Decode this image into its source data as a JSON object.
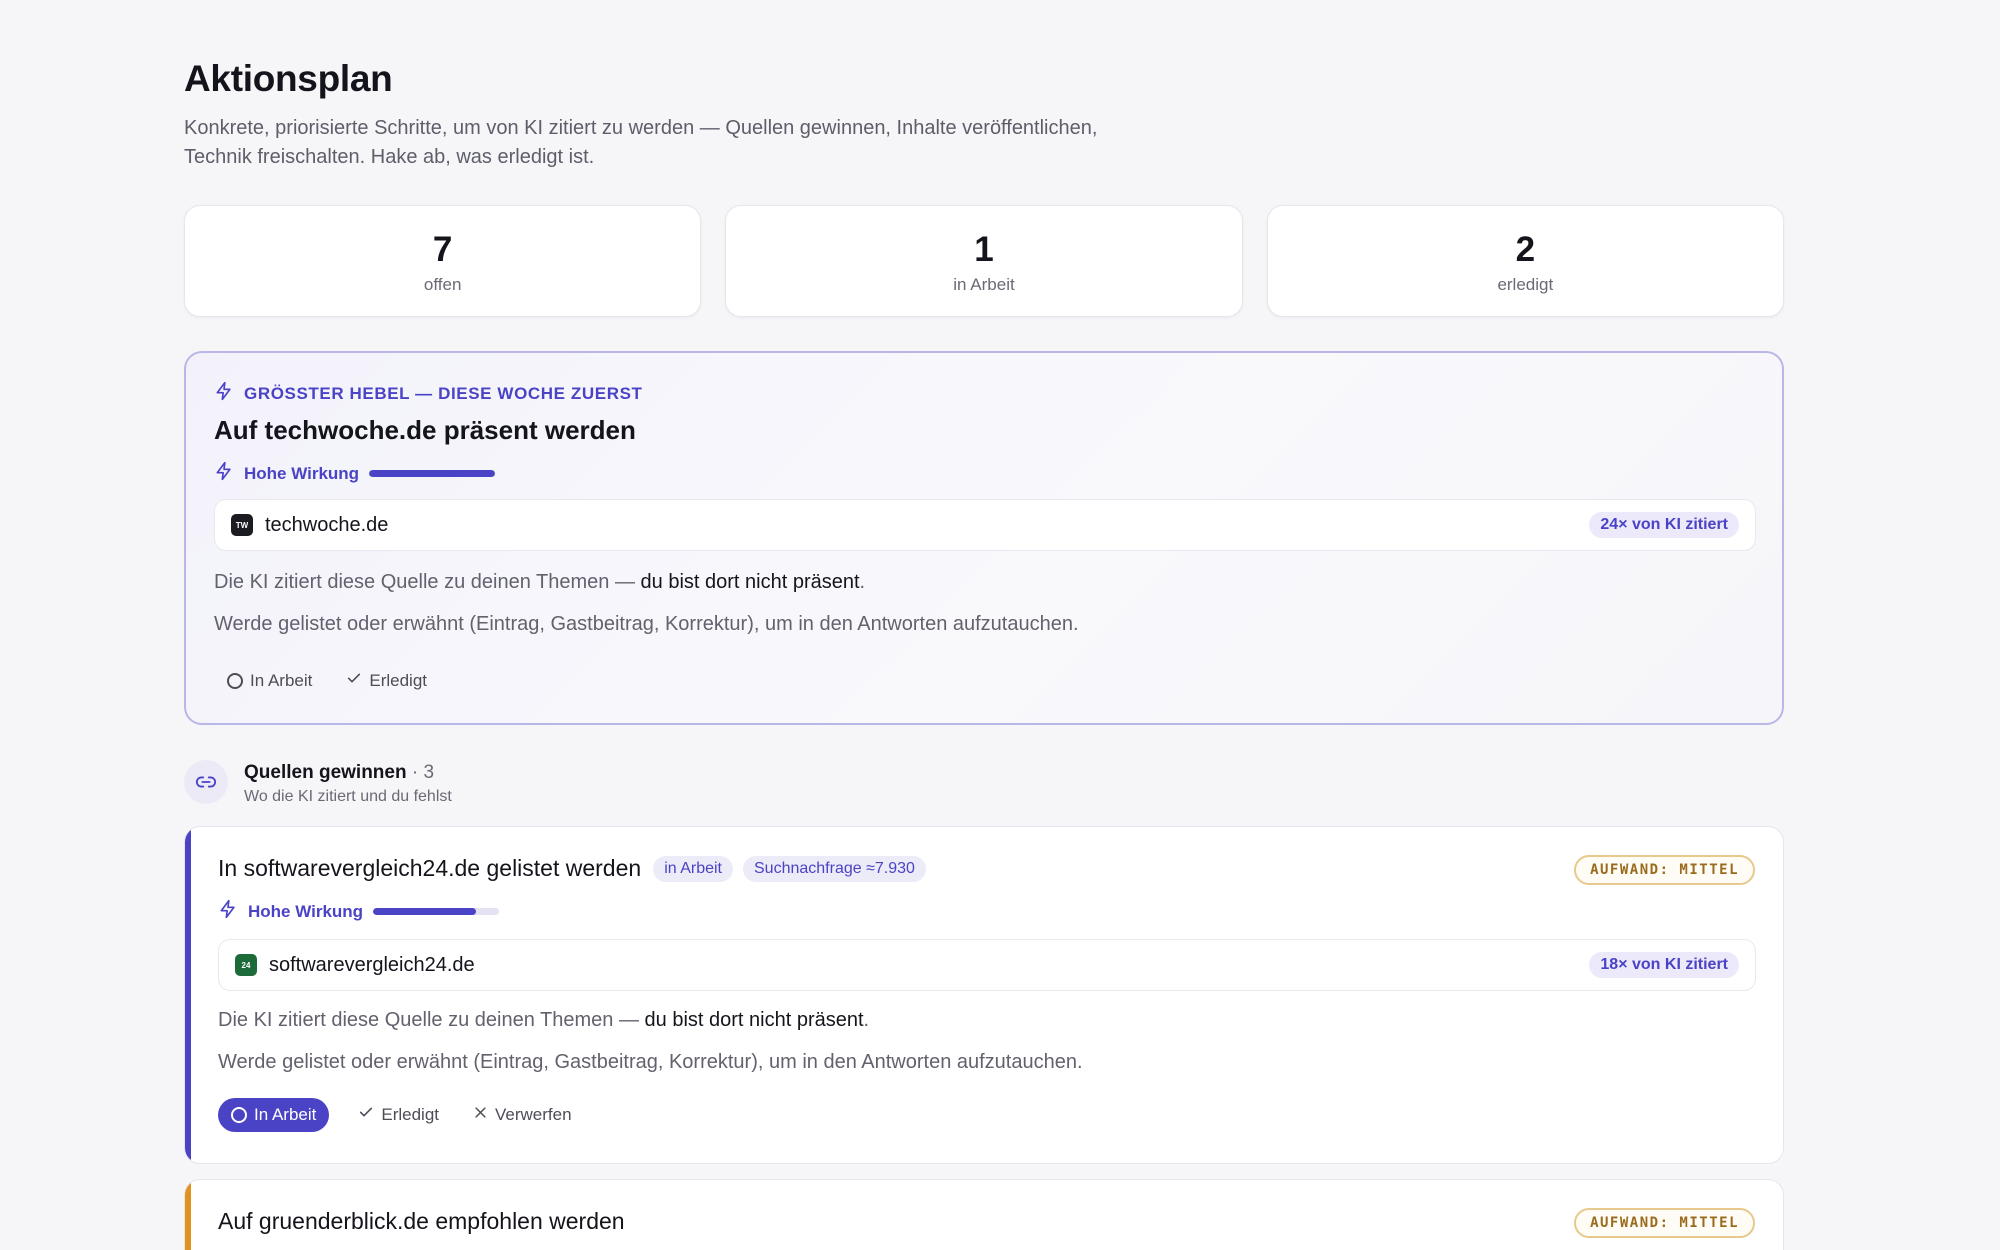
{
  "header": {
    "title": "Aktionsplan",
    "description_line1": "Konkrete, priorisierte Schritte, um von KI zitiert zu werden — Quellen gewinnen, Inhalte veröffentlichen,",
    "description_line2": "Technik freischalten. Hake ab, was erledigt ist."
  },
  "stats": [
    {
      "value": "7",
      "label": "offen"
    },
    {
      "value": "1",
      "label": "in Arbeit"
    },
    {
      "value": "2",
      "label": "erledigt"
    }
  ],
  "colors": {
    "accent": "#4a43c6",
    "effort_border": "#e7c98e",
    "effort_text": "#9a6b1c",
    "accent_orange": "#e0921e"
  },
  "hero": {
    "kicker": "GRÖSSTER HEBEL — DIESE WOCHE ZUERST",
    "title": "Auf techwoche.de präsent werden",
    "impact_label": "Hohe Wirkung",
    "impact_level": 1.0,
    "source": {
      "favicon_text": "TW",
      "favicon_color": "#1b1b22",
      "name": "techwoche.de",
      "cited": "24× von KI zitiert"
    },
    "text1_prefix": "Die KI zitiert diese Quelle zu deinen Themen — ",
    "text1_bold": "du bist dort nicht präsent",
    "text1_suffix": ".",
    "text2": "Werde gelistet oder erwähnt (Eintrag, Gastbeitrag, Korrektur), um in den Antworten aufzutauchen.",
    "actions": {
      "in_progress": "In Arbeit",
      "done": "Erledigt"
    }
  },
  "section": {
    "title": "Quellen gewinnen",
    "count": " · 3",
    "subtitle": "Wo die KI zitiert und du fehlst",
    "icon": "link-icon"
  },
  "tasks": [
    {
      "title": "In softwarevergleich24.de gelistet werden",
      "status_pill": "in Arbeit",
      "demand_pill": "Suchnachfrage ≈7.930",
      "effort": "AUFWAND: MITTEL",
      "impact_label": "Hohe Wirkung",
      "impact_level": 0.82,
      "source": {
        "favicon_text": "24",
        "favicon_color": "#1e6b3a",
        "name": "softwarevergleich24.de",
        "cited": "18× von KI zitiert"
      },
      "text1_prefix": "Die KI zitiert diese Quelle zu deinen Themen — ",
      "text1_bold": "du bist dort nicht präsent",
      "text1_suffix": ".",
      "text2": "Werde gelistet oder erwähnt (Eintrag, Gastbeitrag, Korrektur), um in den Antworten aufzutauchen.",
      "actions": {
        "in_progress": "In Arbeit",
        "done": "Erledigt",
        "discard": "Verwerfen"
      }
    },
    {
      "title": "Auf gruenderblick.de empfohlen werden",
      "effort": "AUFWAND: MITTEL"
    }
  ]
}
